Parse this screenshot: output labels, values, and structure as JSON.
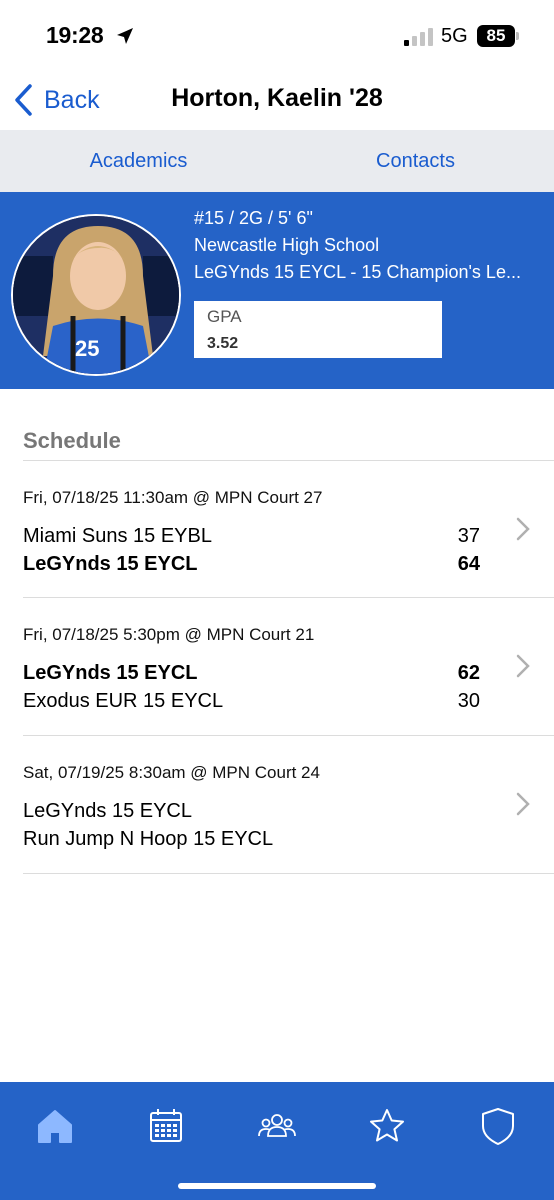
{
  "status_bar": {
    "time": "19:28",
    "network": "5G",
    "battery": "85"
  },
  "nav": {
    "back_label": "Back",
    "title": "Horton, Kaelin '28"
  },
  "tabs": [
    {
      "label": "Academics"
    },
    {
      "label": "Contacts"
    }
  ],
  "profile": {
    "line1": "#15 / 2G / 5' 6\"",
    "line2": "Newcastle High School",
    "line3": "LeGYnds 15 EYCL - 15 Champion's Le...",
    "gpa_label": "GPA",
    "gpa_value": "3.52",
    "avatar_icon": "player-photo"
  },
  "schedule": {
    "heading": "Schedule",
    "games": [
      {
        "date": "Fri, 07/18/25 11:30am @ MPN Court 27",
        "team1": "Miami Suns 15 EYBL",
        "score1": "37",
        "team2": "LeGYnds 15 EYCL",
        "score2": "64"
      },
      {
        "date": "Fri, 07/18/25 5:30pm @ MPN Court 21",
        "team1": "LeGYnds 15 EYCL",
        "score1": "62",
        "team2": "Exodus EUR 15 EYCL",
        "score2": "30"
      },
      {
        "date": "Sat, 07/19/25 8:30am @ MPN Court 24",
        "team1": "LeGYnds 15 EYCL",
        "score1": "",
        "team2": "Run Jump N Hoop 15 EYCL",
        "score2": ""
      }
    ]
  },
  "tabbar": {
    "icons": [
      "home-icon",
      "calendar-icon",
      "people-icon",
      "star-icon",
      "shield-icon"
    ]
  },
  "colors": {
    "accent": "#2563c7",
    "link": "#1a5ccf",
    "tabs_bg": "#e9ebef"
  }
}
